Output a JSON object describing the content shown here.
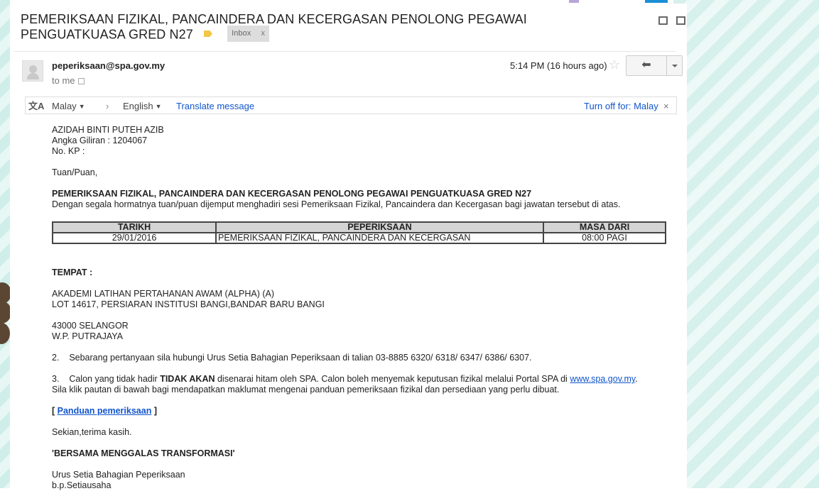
{
  "email": {
    "subject": "PEMERIKSAAN FIZIKAL, PANCAINDERA DAN KECERGASAN PENOLONG PEGAWAI PENGUATKUASA GRED N27",
    "label_chip": "Inbox",
    "label_chip_close": "x",
    "sender": "peperiksaan@spa.gov.my",
    "recipient": "to me",
    "time": "5:14 PM (16 hours ago)"
  },
  "translate": {
    "from_lang": "Malay",
    "to_lang": "English",
    "arrow": "›",
    "translate_link": "Translate message",
    "turn_off": "Turn off for: Malay",
    "close": "×"
  },
  "letter": {
    "name": "AZIDAH BINTI PUTEH AZIB",
    "angka_giliran": "Angka Giliran : 1204067",
    "no_kp": "No. KP :",
    "salutation": "Tuan/Puan,",
    "heading": "PEMERIKSAAN FIZIKAL, PANCAINDERA DAN KECERGASAN PENOLONG PEGAWAI PENGUATKUASA GRED N27",
    "intro": "Dengan segala hormatnya tuan/puan dijemput menghadiri sesi Pemeriksaan Fizikal, Pancaindera dan Kecergasan bagi jawatan tersebut di atas.",
    "table": {
      "headers": [
        "TARIKH",
        "PEPERIKSAAN",
        "MASA DARI"
      ],
      "row": [
        "29/01/2016",
        "PEMERIKSAAN FIZIKAL, PANCAINDERA DAN KECERGASAN",
        "08:00 PAGI"
      ]
    },
    "tempat_label": "TEMPAT :",
    "address_1": "AKADEMI LATIHAN PERTAHANAN AWAM (ALPHA) (A)",
    "address_2": "LOT 14617, PERSIARAN INSTITUSI BANGI,BANDAR BARU BANGI",
    "address_3": "43000 SELANGOR",
    "address_4": "W.P. PUTRAJAYA",
    "point_2": "2.    Sebarang pertanyaan sila hubungi Urus Setia Bahagian Peperiksaan di talian 03-8885 6320/ 6318/ 6347/ 6386/ 6307.",
    "point_3_prefix": "3.    Calon yang tidak hadir ",
    "point_3_bold": "TIDAK AKAN",
    "point_3_mid": " disenarai hitam oleh SPA. Calon boleh menyemak keputusan fizikal melalui Portal SPA di ",
    "point_3_link": "www.spa.gov.my",
    "point_3_end": ".",
    "point_3_line2": "Sila klik pautan di bawah bagi mendapatkan maklumat mengenai panduan pemeriksaan fizikal dan persediaan yang perlu dibuat.",
    "guide_open": "[ ",
    "guide_link": "Panduan pemeriksaan",
    "guide_close": " ]",
    "closing": "Sekian,terima kasih.",
    "motto": "'BERSAMA MENGGALAS TRANSFORMASI'",
    "signature_1": "Urus Setia Bahagian Peperiksaan",
    "signature_2": "b.p.Setiausaha"
  },
  "icons": {
    "reply": "reply-icon",
    "star": "star-icon",
    "print": "print-icon",
    "new_window": "new-window-icon",
    "translate": "translate-icon"
  }
}
